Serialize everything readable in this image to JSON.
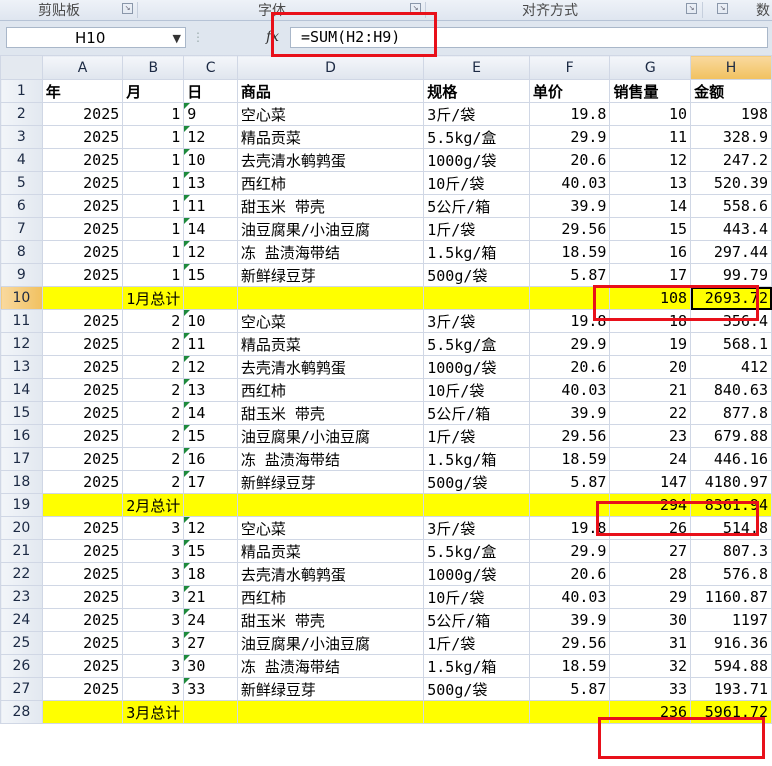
{
  "ribbon": {
    "clipboard": "剪贴板",
    "font": "字体",
    "alignment": "对齐方式",
    "number_partial": "数"
  },
  "formula_bar": {
    "name_box": "H10",
    "fx_symbol": "fx",
    "formula": "=SUM(H2:H9)"
  },
  "columns": [
    "A",
    "B",
    "C",
    "D",
    "E",
    "F",
    "G",
    "H"
  ],
  "selected_column": "H",
  "selected_row": 10,
  "header_row": {
    "row": 1,
    "cells": [
      "年",
      "月",
      "日",
      "商品",
      "规格",
      "单价",
      "销售量",
      "金额"
    ]
  },
  "data_rows": [
    {
      "row": 2,
      "year": "2025",
      "month": "1",
      "day": "9",
      "product": "空心菜",
      "spec": "3斤/袋",
      "price": "19.8",
      "qty": "10",
      "amount": "198"
    },
    {
      "row": 3,
      "year": "2025",
      "month": "1",
      "day": "12",
      "product": "精品贡菜",
      "spec": "5.5kg/盒",
      "price": "29.9",
      "qty": "11",
      "amount": "328.9"
    },
    {
      "row": 4,
      "year": "2025",
      "month": "1",
      "day": "10",
      "product": "去壳清水鹌鹑蛋",
      "spec": "1000g/袋",
      "price": "20.6",
      "qty": "12",
      "amount": "247.2"
    },
    {
      "row": 5,
      "year": "2025",
      "month": "1",
      "day": "13",
      "product": "西红柿",
      "spec": "10斤/袋",
      "price": "40.03",
      "qty": "13",
      "amount": "520.39"
    },
    {
      "row": 6,
      "year": "2025",
      "month": "1",
      "day": "11",
      "product": "甜玉米 带壳",
      "spec": "5公斤/箱",
      "price": "39.9",
      "qty": "14",
      "amount": "558.6"
    },
    {
      "row": 7,
      "year": "2025",
      "month": "1",
      "day": "14",
      "product": "油豆腐果/小油豆腐",
      "spec": "1斤/袋",
      "price": "29.56",
      "qty": "15",
      "amount": "443.4"
    },
    {
      "row": 8,
      "year": "2025",
      "month": "1",
      "day": "12",
      "product": "冻 盐渍海带结",
      "spec": "1.5kg/箱",
      "price": "18.59",
      "qty": "16",
      "amount": "297.44"
    },
    {
      "row": 9,
      "year": "2025",
      "month": "1",
      "day": "15",
      "product": "新鲜绿豆芽",
      "spec": "500g/袋",
      "price": "5.87",
      "qty": "17",
      "amount": "99.79"
    },
    {
      "row": 10,
      "total": true,
      "label": "1月总计",
      "qty": "108",
      "amount": "2693.72"
    },
    {
      "row": 11,
      "year": "2025",
      "month": "2",
      "day": "10",
      "product": "空心菜",
      "spec": "3斤/袋",
      "price": "19.8",
      "qty": "18",
      "amount": "356.4"
    },
    {
      "row": 12,
      "year": "2025",
      "month": "2",
      "day": "11",
      "product": "精品贡菜",
      "spec": "5.5kg/盒",
      "price": "29.9",
      "qty": "19",
      "amount": "568.1"
    },
    {
      "row": 13,
      "year": "2025",
      "month": "2",
      "day": "12",
      "product": "去壳清水鹌鹑蛋",
      "spec": "1000g/袋",
      "price": "20.6",
      "qty": "20",
      "amount": "412"
    },
    {
      "row": 14,
      "year": "2025",
      "month": "2",
      "day": "13",
      "product": "西红柿",
      "spec": "10斤/袋",
      "price": "40.03",
      "qty": "21",
      "amount": "840.63"
    },
    {
      "row": 15,
      "year": "2025",
      "month": "2",
      "day": "14",
      "product": "甜玉米 带壳",
      "spec": "5公斤/箱",
      "price": "39.9",
      "qty": "22",
      "amount": "877.8"
    },
    {
      "row": 16,
      "year": "2025",
      "month": "2",
      "day": "15",
      "product": "油豆腐果/小油豆腐",
      "spec": "1斤/袋",
      "price": "29.56",
      "qty": "23",
      "amount": "679.88"
    },
    {
      "row": 17,
      "year": "2025",
      "month": "2",
      "day": "16",
      "product": "冻 盐渍海带结",
      "spec": "1.5kg/箱",
      "price": "18.59",
      "qty": "24",
      "amount": "446.16"
    },
    {
      "row": 18,
      "year": "2025",
      "month": "2",
      "day": "17",
      "product": "新鲜绿豆芽",
      "spec": "500g/袋",
      "price": "5.87",
      "qty": "147",
      "amount": "4180.97"
    },
    {
      "row": 19,
      "total": true,
      "label": "2月总计",
      "qty": "294",
      "amount": "8361.94"
    },
    {
      "row": 20,
      "year": "2025",
      "month": "3",
      "day": "12",
      "product": "空心菜",
      "spec": "3斤/袋",
      "price": "19.8",
      "qty": "26",
      "amount": "514.8"
    },
    {
      "row": 21,
      "year": "2025",
      "month": "3",
      "day": "15",
      "product": "精品贡菜",
      "spec": "5.5kg/盒",
      "price": "29.9",
      "qty": "27",
      "amount": "807.3"
    },
    {
      "row": 22,
      "year": "2025",
      "month": "3",
      "day": "18",
      "product": "去壳清水鹌鹑蛋",
      "spec": "1000g/袋",
      "price": "20.6",
      "qty": "28",
      "amount": "576.8"
    },
    {
      "row": 23,
      "year": "2025",
      "month": "3",
      "day": "21",
      "product": "西红柿",
      "spec": "10斤/袋",
      "price": "40.03",
      "qty": "29",
      "amount": "1160.87"
    },
    {
      "row": 24,
      "year": "2025",
      "month": "3",
      "day": "24",
      "product": "甜玉米 带壳",
      "spec": "5公斤/箱",
      "price": "39.9",
      "qty": "30",
      "amount": "1197"
    },
    {
      "row": 25,
      "year": "2025",
      "month": "3",
      "day": "27",
      "product": "油豆腐果/小油豆腐",
      "spec": "1斤/袋",
      "price": "29.56",
      "qty": "31",
      "amount": "916.36"
    },
    {
      "row": 26,
      "year": "2025",
      "month": "3",
      "day": "30",
      "product": "冻 盐渍海带结",
      "spec": "1.5kg/箱",
      "price": "18.59",
      "qty": "32",
      "amount": "594.88"
    },
    {
      "row": 27,
      "year": "2025",
      "month": "3",
      "day": "33",
      "product": "新鲜绿豆芽",
      "spec": "500g/袋",
      "price": "5.87",
      "qty": "33",
      "amount": "193.71"
    },
    {
      "row": 28,
      "total": true,
      "label": "3月总计",
      "qty": "236",
      "amount": "5961.72"
    }
  ],
  "colors": {
    "total_row_fill": "#ffff00",
    "annotation_box": "#e8101a",
    "text_flag_triangle": "#1e8a3c",
    "selected_header": "#f6cf7e"
  }
}
